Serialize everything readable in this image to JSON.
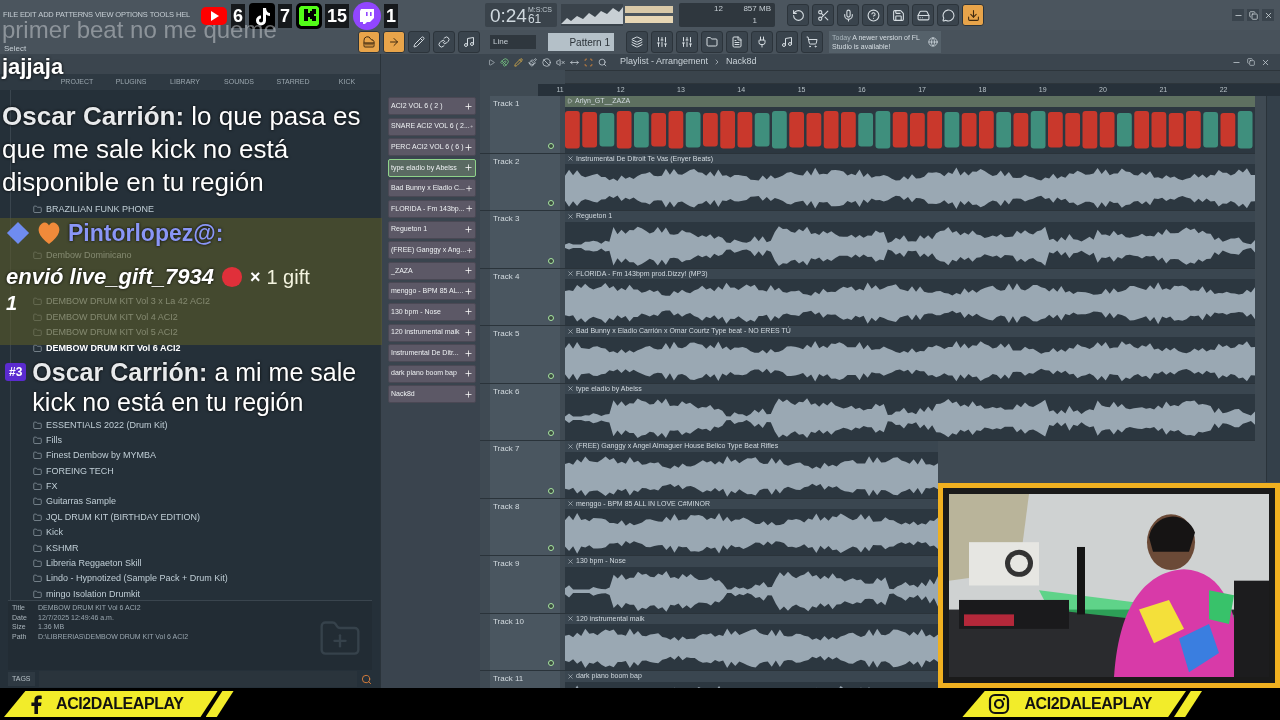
{
  "menu": [
    "FILE",
    "EDIT",
    "ADD",
    "PATTERNS",
    "VIEW",
    "OPTIONS",
    "TOOLS",
    "HEL"
  ],
  "stream_counters": [
    {
      "kind": "youtube",
      "count": "6"
    },
    {
      "kind": "tiktok",
      "count": "7"
    },
    {
      "kind": "kick",
      "count": "15"
    },
    {
      "kind": "twitch",
      "count": "1"
    }
  ],
  "transport": {
    "time": "0:24",
    "time_cs": "61",
    "time_unit": "M:S:CS",
    "cpu": "12",
    "memory": "857 MB",
    "polyphony": "1"
  },
  "toolbar": {
    "hint": "Select",
    "snap": "Line",
    "pattern": "Pattern 1"
  },
  "news": {
    "label": "Today",
    "message": "A newer version of FL Studio is available!"
  },
  "chat_overlay": {
    "ghost_message": "primer beat no me queme",
    "messages": [
      {
        "kind": "plain",
        "text": "jajjaja"
      },
      {
        "kind": "chat",
        "user": "Oscar Carrión:",
        "text": "lo que pasa es que me sale kick no está disponible en tu región"
      },
      {
        "kind": "gift",
        "user": "Pintorlopez@:",
        "text": "envió live_gift_7934",
        "times": "×",
        "gift": "1 gift",
        "amount": "1"
      },
      {
        "kind": "chat",
        "badge": "#3",
        "user": "Oscar Carrión:",
        "text": "a mi me sale kick no está en tu región"
      }
    ]
  },
  "browser": {
    "tabs": [
      {
        "label": "PROJECT",
        "selected": false
      },
      {
        "label": "PLUGINS",
        "selected": false
      },
      {
        "label": "LIBRARY",
        "selected": false
      },
      {
        "label": "SOUNDS",
        "selected": false
      },
      {
        "label": "STARRED",
        "selected": false
      },
      {
        "label": "KICK",
        "selected": false
      }
    ],
    "items": [
      {
        "label": "BRAZILIAN FUNK PHONE",
        "selected": false
      },
      {
        "label": "Dembow Dominicano",
        "selected": false
      },
      {
        "label": "DEMBOW DRUM KIT Vol 3 x La 42 ACI2",
        "selected": false
      },
      {
        "label": "DEMBOW DRUM KIT Vol 4 ACI2",
        "selected": false
      },
      {
        "label": "DEMBOW DRUM KIT Vol 5 ACI2",
        "selected": false
      },
      {
        "label": "DEMBOW DRUM KIT Vol 6 ACI2",
        "selected": true
      },
      {
        "label": "ESSENTIALS 2022 (Drum Kit)",
        "selected": false
      },
      {
        "label": "Fills",
        "selected": false
      },
      {
        "label": "Finest Dembow by MYMBA",
        "selected": false
      },
      {
        "label": "FOREING TECH",
        "selected": false
      },
      {
        "label": "FX",
        "selected": false
      },
      {
        "label": "Guitarras Sample",
        "selected": false
      },
      {
        "label": "JQL DRUM KIT (BIRTHDAY EDITION)",
        "selected": false
      },
      {
        "label": "Kick",
        "selected": false
      },
      {
        "label": "KSHMR",
        "selected": false
      },
      {
        "label": "Libreria Reggaeton Skill",
        "selected": false
      },
      {
        "label": "Lindo - Hypnotized (Sample Pack + Drum Kit)",
        "selected": false
      },
      {
        "label": "mingo Isolation Drumkit",
        "selected": false
      }
    ],
    "info": [
      {
        "label": "Title",
        "value": "DEMBOW DRUM KIT Vol 6 ACI2"
      },
      {
        "label": "Date",
        "value": "12/7/2025 12:49:46 a.m."
      },
      {
        "label": "Size",
        "value": "1.36 MB"
      },
      {
        "label": "Path",
        "value": "D:\\LIBRERIAS\\DEMBOW DRUM KIT Vol 6 ACI2"
      }
    ],
    "tags_label": "TAGS"
  },
  "clip_list": [
    {
      "label": "ACI2 VOL 6 ( 2 )",
      "selected": false
    },
    {
      "label": "SNARE ACI2 VOL 6 ( 2...",
      "selected": false
    },
    {
      "label": "PERC ACI2 VOL 6 ( 6 )",
      "selected": false
    },
    {
      "label": "type eladio by Abelss",
      "selected": true
    },
    {
      "label": "Bad Bunny x Eladio C...",
      "selected": false
    },
    {
      "label": "FLORIDA - Fm 143bp...",
      "selected": false
    },
    {
      "label": "Regueton 1",
      "selected": false
    },
    {
      "label": "(FREE) Ganggy x Ang...",
      "selected": false
    },
    {
      "label": "_ZAZA",
      "selected": false
    },
    {
      "label": "menggo - BPM 85 AL...",
      "selected": false
    },
    {
      "label": "130 bpm - Nose",
      "selected": false
    },
    {
      "label": "120 instrumental maik",
      "selected": false
    },
    {
      "label": "Instrumental De Ditr...",
      "selected": false
    },
    {
      "label": "dark piano boom bap",
      "selected": false
    },
    {
      "label": "Nack8d",
      "selected": false
    }
  ],
  "playlist": {
    "title": "Playlist - Arrangement",
    "pattern": "Nack8d",
    "ruler": [
      "11",
      "12",
      "13",
      "14",
      "15",
      "16",
      "17",
      "18",
      "19",
      "20",
      "21",
      "22"
    ],
    "tracks": [
      {
        "name": "Track 1",
        "kind": "pattern",
        "clip": "Arlyn_GT__ZAZA"
      },
      {
        "name": "Track 2",
        "kind": "audio",
        "clip": "Instrumental De Ditroit Te Vas (Enyer Beats)"
      },
      {
        "name": "Track 3",
        "kind": "audio",
        "clip": "Regueton 1"
      },
      {
        "name": "Track 4",
        "kind": "audio",
        "clip": "FLORIDA - Fm 143bpm prod.Dizzy! (MP3)"
      },
      {
        "name": "Track 5",
        "kind": "audio",
        "clip": "Bad Bunny x Eladio Carrión x Omar Courtz Type beat - NO ERES TÚ"
      },
      {
        "name": "Track 6",
        "kind": "audio",
        "clip": "type eladio by Abelss"
      },
      {
        "name": "Track 7",
        "kind": "audio",
        "clip": "(FREE) Ganggy x Angel Almaguer House Belico Type Beat Rifles"
      },
      {
        "name": "Track 8",
        "kind": "audio",
        "clip": "menggo - BPM 85 ALL IN LOVE C#MINOR"
      },
      {
        "name": "Track 9",
        "kind": "audio",
        "clip": "130 bpm - Nose"
      },
      {
        "name": "Track 10",
        "kind": "audio",
        "clip": "120 instrumental maik"
      },
      {
        "name": "Track 11",
        "kind": "audio",
        "clip": "dark piano boom bap"
      }
    ]
  },
  "footer": [
    {
      "kind": "facebook",
      "handle": "ACI2DALEAPLAY"
    },
    {
      "kind": "instagram",
      "handle": "ACI2DALEAPLAY"
    }
  ]
}
